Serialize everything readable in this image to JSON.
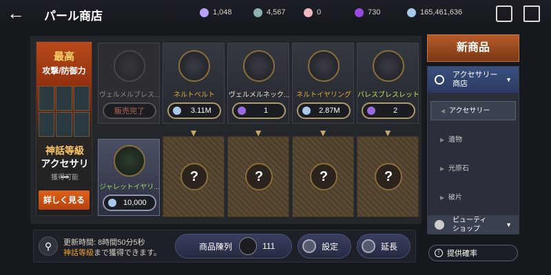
{
  "header": {
    "title": "パール商店",
    "currencies": [
      {
        "icon": "pearl-currency-icon",
        "value": "1,048",
        "color": "#b8a0ff"
      },
      {
        "icon": "silver-coin-icon",
        "value": "4,567",
        "color": "#8fb3b0"
      },
      {
        "icon": "pink-gem-icon",
        "value": "0",
        "color": "#f0b8c0"
      },
      {
        "icon": "purple-orb-icon",
        "value": "730",
        "color": "#9a4ae0"
      },
      {
        "icon": "silver-currency-icon",
        "value": "165,461,636",
        "color": "#a8c8e8"
      }
    ]
  },
  "promo": {
    "best": "最高",
    "attack_defense": "攻撃/防御力",
    "myth_grade": "神話等級",
    "accessory": "アクセサリー",
    "obtainable": "獲得可能",
    "details_button": "詳しく見る"
  },
  "top_items": [
    {
      "name": "ヴェルメルブレス...",
      "price": "販売完了",
      "sold": true,
      "currency_icon": ""
    },
    {
      "name": "ネルトベルト",
      "price": "3.11M",
      "sold": false,
      "currency_icon": "silver-currency-icon",
      "coin_color": "#a8c8e8"
    },
    {
      "name": "ヴェルメルネック...",
      "price": "1",
      "sold": false,
      "currency_icon": "pearl-currency-icon",
      "coin_color": "#9a6ae0"
    },
    {
      "name": "ネルトイヤリング",
      "price": "2.87M",
      "sold": false,
      "currency_icon": "silver-currency-icon",
      "coin_color": "#a8c8e8"
    },
    {
      "name": "バレスブレスレット",
      "price": "2",
      "sold": false,
      "currency_icon": "pearl-currency-icon",
      "coin_color": "#9a6ae0"
    }
  ],
  "bottom_items": [
    {
      "name": "ジャレットイヤリ...",
      "price": "10,000",
      "currency_icon": "silver-currency-icon"
    }
  ],
  "locked_slots": [
    "?",
    "?",
    "?",
    "?"
  ],
  "bottom_bar": {
    "refresh_line1": "更新時間: 8時間50分5秒",
    "refresh_line2_highlight": "神話等級",
    "refresh_line2_rest": "まで獲得できます。",
    "display_label": "商品陳列",
    "display_count": "111",
    "settings_label": "設定",
    "extend_label": "延長"
  },
  "sidebar": {
    "new_items": "新商品",
    "category_label": "アクセサリー\n商店",
    "subcategories": [
      {
        "label": "アクセサリー",
        "selected": true
      },
      {
        "label": "遺物",
        "selected": false
      },
      {
        "label": "光原石",
        "selected": false
      },
      {
        "label": "破片",
        "selected": false
      }
    ],
    "beauty_shop": "ビューティ\nショップ",
    "probability": "提供確率"
  }
}
